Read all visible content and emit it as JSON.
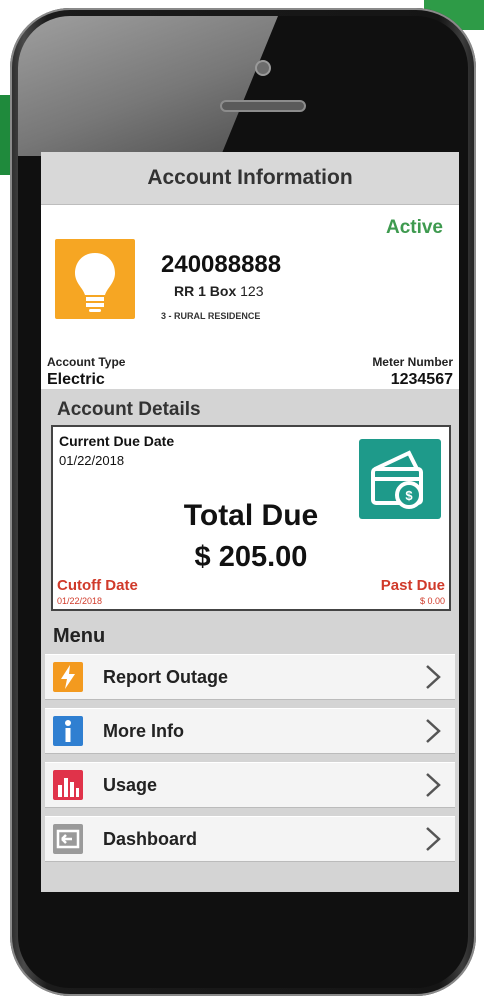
{
  "screen": {
    "title": "Account Information"
  },
  "account": {
    "status": "Active",
    "number": "240088888",
    "address_prefix": "RR 1 Box",
    "address_num": "123",
    "class": "3 - RURAL RESIDENCE",
    "icon": "lightbulb-icon",
    "type_label": "Account Type",
    "type_value": "Electric",
    "meter_label": "Meter Number",
    "meter_value": "1234567"
  },
  "details": {
    "section_title": "Account Details",
    "due_label": "Current Due Date",
    "due_date": "01/22/2018",
    "total_label": "Total Due",
    "total_amount": "$ 205.00",
    "cutoff_label": "Cutoff Date",
    "cutoff_date": "01/22/2018",
    "pastdue_label": "Past Due",
    "pastdue_amount": "$ 0.00",
    "pay_icon": "payment-cards-icon"
  },
  "menu": {
    "title": "Menu",
    "items": [
      {
        "label": "Report Outage",
        "icon": "lightning-bolt-icon",
        "color": "#f39a1f"
      },
      {
        "label": "More Info",
        "icon": "info-icon",
        "color": "#2f7fd1"
      },
      {
        "label": "Usage",
        "icon": "bar-chart-icon",
        "color": "#e0334a"
      },
      {
        "label": "Dashboard",
        "icon": "dashboard-icon",
        "color": "#9a9a9a"
      }
    ]
  },
  "colors": {
    "active_green": "#3e9a4f",
    "bulb_orange": "#f6a623",
    "pay_teal": "#1e9a8a",
    "alert_red": "#d03a2a"
  }
}
